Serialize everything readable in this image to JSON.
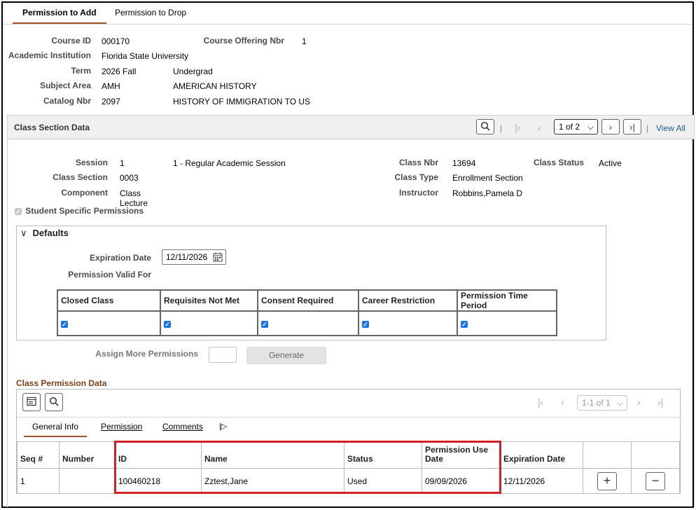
{
  "tabs": [
    {
      "label": "Permission to Add",
      "active": true
    },
    {
      "label": "Permission to Drop",
      "active": false
    }
  ],
  "header": {
    "course_id_label": "Course ID",
    "course_id": "000170",
    "offering_label": "Course Offering Nbr",
    "offering": "1",
    "institution_label": "Academic Institution",
    "institution": "Florida State University",
    "term_label": "Term",
    "term": "2026 Fall",
    "term_career": "Undergrad",
    "subject_label": "Subject Area",
    "subject": "AMH",
    "subject_desc": "AMERICAN HISTORY",
    "catalog_label": "Catalog Nbr",
    "catalog": "2097",
    "catalog_desc": "HISTORY OF IMMIGRATION TO US"
  },
  "section": {
    "title": "Class Section Data",
    "pager": "1 of 2",
    "view_all": "View All",
    "session_label": "Session",
    "session": "1",
    "session_desc": "1 - Regular Academic Session",
    "class_section_label": "Class Section",
    "class_section": "0003",
    "component_label": "Component",
    "component_line1": "Class",
    "component_line2": "Lecture",
    "class_nbr_label": "Class Nbr",
    "class_nbr": "13694",
    "class_type_label": "Class Type",
    "class_type": "Enrollment Section",
    "instructor_label": "Instructor",
    "instructor": "Robbins,Pamela D",
    "status_label": "Class Status",
    "status": "Active",
    "student_specific_label": "Student Specific Permissions"
  },
  "defaults": {
    "title": "Defaults",
    "expiration_label": "Expiration Date",
    "expiration": "12/11/2026",
    "valid_for_label": "Permission Valid For",
    "columns": [
      "Closed Class",
      "Requisites Not Met",
      "Consent Required",
      "Career Restriction",
      "Permission Time Period"
    ],
    "checked": [
      true,
      true,
      true,
      true,
      true
    ]
  },
  "assign": {
    "label": "Assign More Permissions",
    "value": "",
    "generate_label": "Generate"
  },
  "permissions": {
    "title": "Class Permission Data",
    "pager": "1-1 of 1",
    "tabs": [
      "General Info",
      "Permission",
      "Comments"
    ],
    "columns": [
      "Seq #",
      "Number",
      "ID",
      "Name",
      "Status",
      "Permission Use Date",
      "Expiration Date"
    ],
    "rows": [
      {
        "seq": "1",
        "number": "",
        "id": "100460218",
        "name": "Zztest,Jane",
        "status": "Used",
        "use_date": "09/09/2026",
        "expiration": "12/11/2026"
      }
    ]
  },
  "colors": {
    "accent": "#a0522d",
    "link": "#1f5f9f",
    "highlight": "#d0202a",
    "check": "#1a73e8"
  }
}
